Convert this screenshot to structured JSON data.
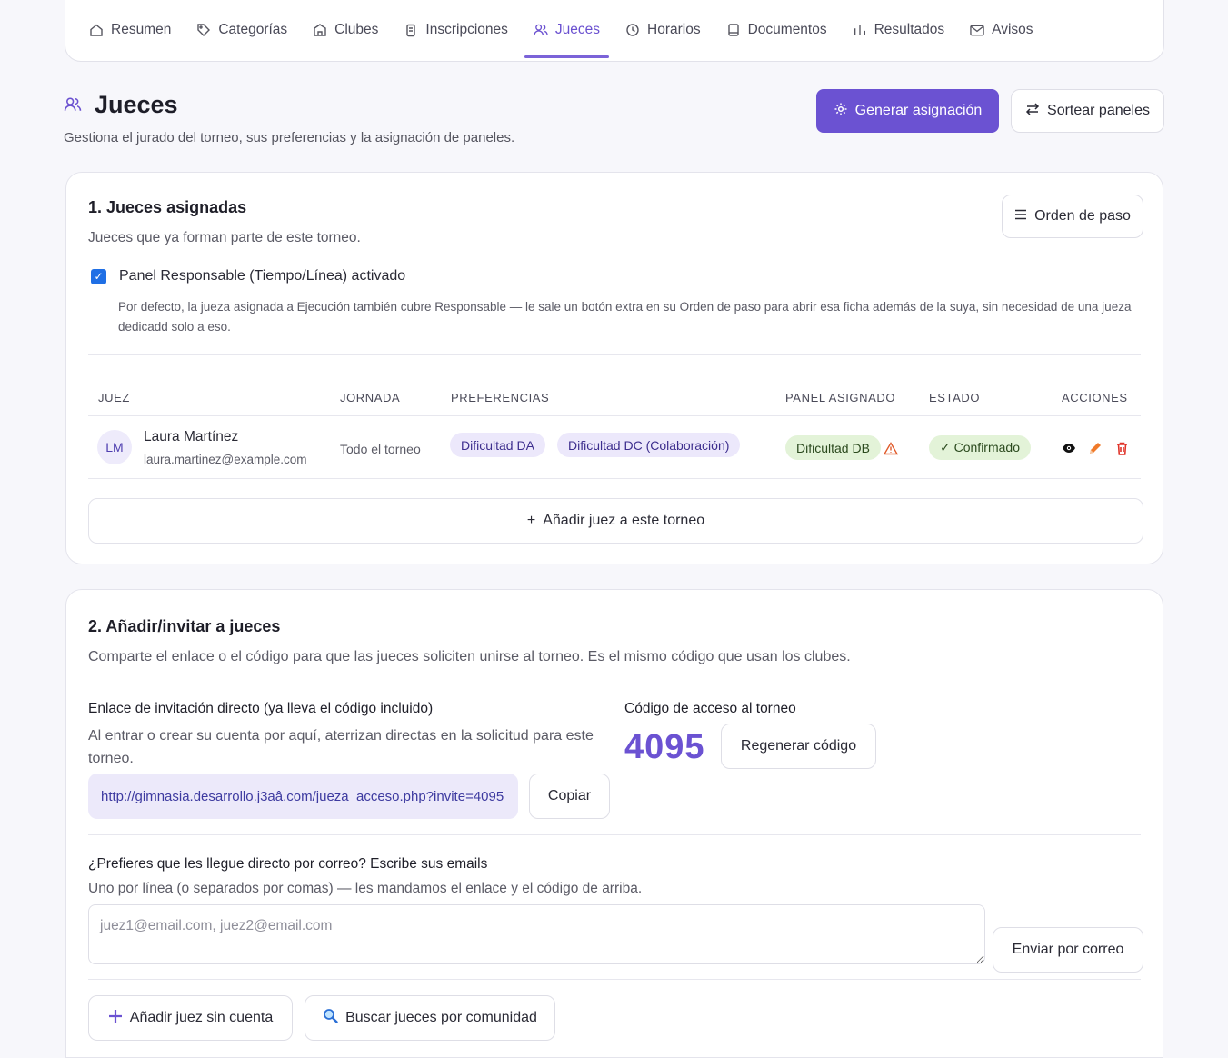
{
  "tabs": [
    {
      "label": "Resumen",
      "icon": "home-icon"
    },
    {
      "label": "Categorías",
      "icon": "tag-icon"
    },
    {
      "label": "Clubes",
      "icon": "building-icon"
    },
    {
      "label": "Inscripciones",
      "icon": "clipboard-icon"
    },
    {
      "label": "Jueces",
      "icon": "users-icon",
      "active": true
    },
    {
      "label": "Horarios",
      "icon": "clock-icon"
    },
    {
      "label": "Documentos",
      "icon": "tablet-icon"
    },
    {
      "label": "Resultados",
      "icon": "bar-chart-icon"
    },
    {
      "label": "Avisos",
      "icon": "mail-icon"
    }
  ],
  "header": {
    "title": "Jueces",
    "subtitle": "Gestiona el jurado del torneo, sus preferencias y la asignación de paneles.",
    "generate_label": "Generar asignación",
    "shuffle_label": "Sortear paneles"
  },
  "assigned": {
    "title": "1. Jueces asignadas",
    "subtitle": "Jueces que ya forman parte de este torneo.",
    "order_label": "Orden de paso",
    "checkbox_label": "Panel Responsable (Tiempo/Línea) activado",
    "checkbox_checked": true,
    "checkbox_help_1": "Por defecto, la jueza asignada a Ejecución también cubre Responsable — le sale un botón extra en su Orden de paso para abrir esa ficha además de la suya, sin necesidad de una jueza",
    "checkbox_help_2": "dedicadd solo a eso.",
    "columns": {
      "judge": "JUEZ",
      "day": "JORNADA",
      "prefs": "PREFERENCIAS",
      "panel": "PANEL ASIGNADO",
      "status": "ESTADO",
      "actions": "ACCIONES"
    },
    "rows": [
      {
        "initials": "LM",
        "name": "Laura Martínez",
        "email": "laura.martinez@example.com",
        "day": "Todo el torneo",
        "pref1": "Dificultad DA",
        "pref2": "Dificultad DC (Colaboración)",
        "panel": "Dificultad DB",
        "status": "✓ Confirmado"
      }
    ],
    "add_label": "Añadir juez a este torneo"
  },
  "invite": {
    "title": "2. Añadir/invitar a jueces",
    "subtitle": "Comparte el enlace o el código para que las jueces soliciten unirse al torneo. Es el mismo código que usan los clubes.",
    "link_label": "Enlace de invitación directo (ya lleva el código incluido)",
    "link_help_1": "Al entrar o crear su cuenta por aquí, aterrizan directas en la solicitud para este",
    "link_help_2": "torneo.",
    "link_value": "http://gimnasia.desarrollo.j3aâ.com/jueza_acceso.php?invite=4095",
    "copy_label": "Copiar",
    "code_label": "Código de acceso al torneo",
    "code_value": "4095",
    "regen_label": "Regenerar código",
    "email_label": "¿Prefieres que les llegue directo por correo? Escribe sus emails",
    "email_help": "Uno por línea (o separados por comas) — les mandamos el enlace y el código de arriba.",
    "email_placeholder": "juez1@email.com, juez2@email.com",
    "send_label": "Enviar por correo",
    "add_no_account_label": "Añadir juez sin cuenta",
    "search_community_label": "Buscar jueces por comunidad"
  }
}
